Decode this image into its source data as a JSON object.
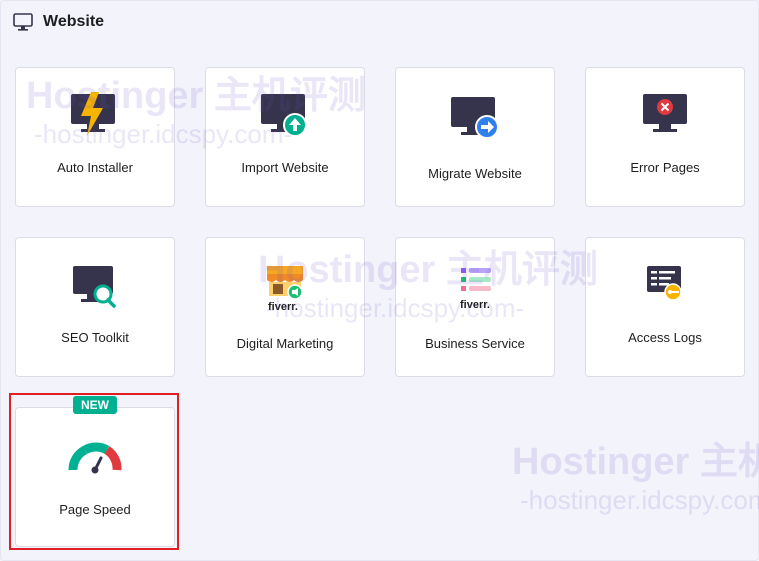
{
  "section": {
    "title": "Website",
    "icon": "monitor-icon"
  },
  "cards": [
    {
      "label": "Auto Installer",
      "icon": "lightning-monitor-icon"
    },
    {
      "label": "Import Website",
      "icon": "import-monitor-icon"
    },
    {
      "label": "Migrate Website",
      "icon": "migrate-monitor-icon"
    },
    {
      "label": "Error Pages",
      "icon": "error-monitor-icon"
    },
    {
      "label": "SEO Toolkit",
      "icon": "seo-search-monitor-icon"
    },
    {
      "label": "Digital Marketing",
      "icon": "fiverr-store-icon",
      "brand": "fiverr."
    },
    {
      "label": "Business Service",
      "icon": "fiverr-list-icon",
      "brand": "fiverr."
    },
    {
      "label": "Access Logs",
      "icon": "log-key-icon"
    },
    {
      "label": "Page Speed",
      "icon": "speedometer-icon",
      "badge": "NEW"
    }
  ],
  "watermark": {
    "line1": "Hostinger 主机评测",
    "line2": "-hostinger.idcspy.com-"
  },
  "colors": {
    "accent_purple": "#673de6",
    "badge_green": "#00b090",
    "highlight_red": "#e01e26",
    "fiverr_green": "#1dbf73"
  }
}
